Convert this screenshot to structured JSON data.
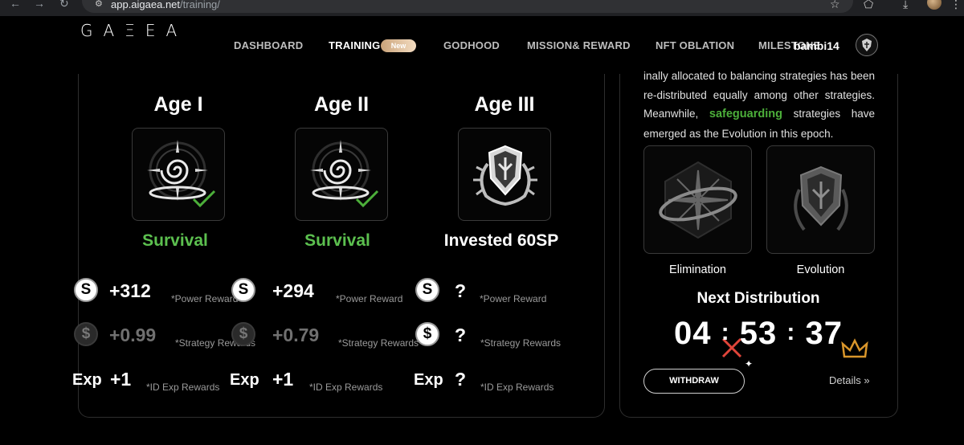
{
  "browser": {
    "url_host": "app.aigaea.net",
    "url_path": "/training/"
  },
  "header": {
    "logo": "GAΞEA",
    "nav": [
      {
        "label": "DASHBOARD"
      },
      {
        "label": "TRAINING",
        "badge": "New"
      },
      {
        "label": "GODHOOD"
      },
      {
        "label": "MISSION& REWARD"
      },
      {
        "label": "NFT OBLATION"
      },
      {
        "label": "MILESTONE"
      }
    ],
    "username": "bambi14"
  },
  "ages": [
    {
      "title": "Age I",
      "status": "Survival",
      "status_color": "#5cc04f",
      "icon": "survival-spiral-icon",
      "completed": true,
      "power_value": "+312",
      "power_label": "*Power Reward",
      "strategy_value": "+0.99",
      "strategy_label": "*Strategy Rewards",
      "exp_prefix": "Exp",
      "exp_value": "+1",
      "exp_label": "*ID Exp Rewards"
    },
    {
      "title": "Age II",
      "status": "Survival",
      "status_color": "#5cc04f",
      "icon": "survival-spiral-icon",
      "completed": true,
      "power_value": "+294",
      "power_label": "*Power Reward",
      "strategy_value": "+0.79",
      "strategy_label": "*Strategy Rewards",
      "exp_prefix": "Exp",
      "exp_value": "+1",
      "exp_label": "*ID Exp Rewards"
    },
    {
      "title": "Age III",
      "status": "Invested 60SP",
      "status_color": "#ffffff",
      "icon": "shield-crest-icon",
      "completed": false,
      "power_value": "?",
      "power_label": "*Power Reward",
      "strategy_value": "?",
      "strategy_label": "*Strategy Rewards",
      "exp_prefix": "Exp",
      "exp_value": "?",
      "exp_label": "*ID Exp Rewards"
    }
  ],
  "coin_glyphs": {
    "power": "S",
    "strategy": "$"
  },
  "epoch": {
    "description_line1": "inally allocated to balancing strategies has been re-distributed equally among other strategies. Meanwhile,",
    "highlight": "safeguarding",
    "description_line2": "strategies have emerged as the Evolution in this epoch.",
    "highlight_color": "#4caf3a",
    "strategies": [
      {
        "label": "Elimination",
        "marker": "x-mark-icon",
        "marker_color": "#e0453a"
      },
      {
        "label": "Evolution",
        "marker": "crown-icon",
        "marker_color": "#d9962b"
      }
    ],
    "next_title": "Next Distribution",
    "timer": {
      "hours": "04",
      "minutes": "53",
      "seconds": "37",
      "sep": ":"
    },
    "withdraw_label": "WITHDRAW",
    "details_label": "Details »"
  }
}
